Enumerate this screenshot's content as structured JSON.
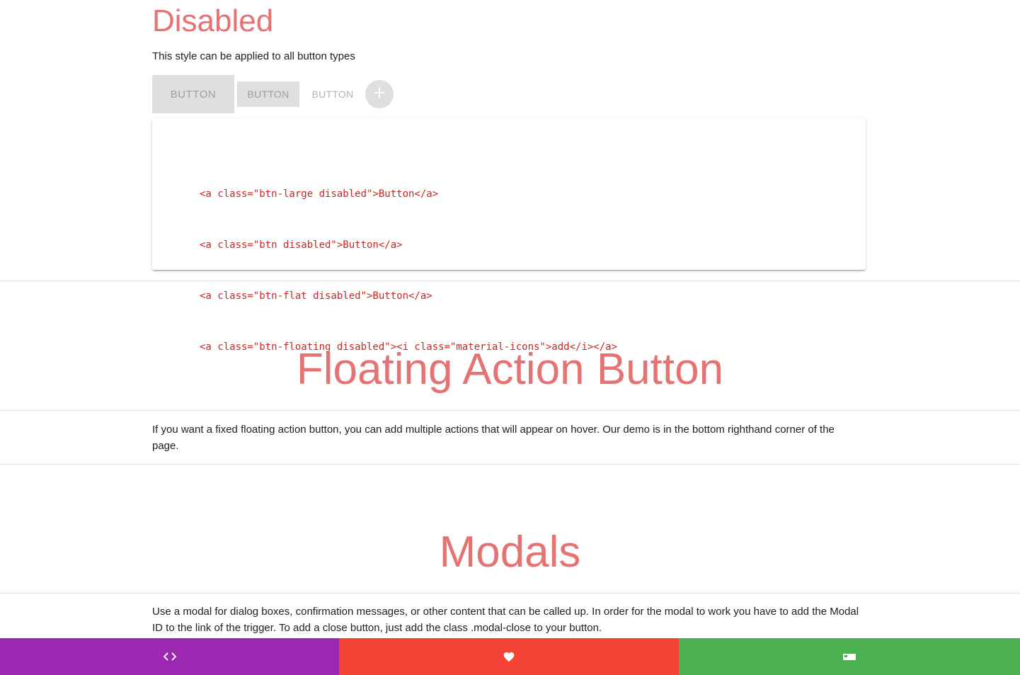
{
  "disabled_section": {
    "title": "Disabled",
    "subtitle": "This style can be applied to all button types",
    "buttons": {
      "large": "BUTTON",
      "normal": "BUTTON",
      "flat": "BUTTON"
    },
    "floating_icon": "plus-icon",
    "code_lines": [
      "<a class=\"btn-large disabled\">Button</a>",
      "<a class=\"btn disabled\">Button</a>",
      "<a class=\"btn-flat disabled\">Button</a>",
      "<a class=\"btn-floating disabled\"><i class=\"material-icons\">add</i></a>"
    ]
  },
  "fab_section": {
    "title": "Floating Action Button",
    "description": "If you want a fixed floating action button, you can add multiple actions that will appear on hover. Our demo is in the bottom righthand corner of the page."
  },
  "modals_section": {
    "title": "Modals",
    "description": "Use a modal for dialog boxes, confirmation messages, or other content that can be called up. In order for the modal to work you have to add the Modal ID to the link of the trigger. To add a close button, just add the class .modal-close to your button."
  },
  "bottom_bar": {
    "items": [
      {
        "icon": "code-icon",
        "color": "#9c27b0"
      },
      {
        "icon": "heart-icon",
        "color": "#f44336"
      },
      {
        "icon": "hotel-icon",
        "color": "#4caf50"
      }
    ]
  },
  "colors": {
    "accent": "#e57373",
    "code": "#c62828",
    "disabled_bg": "#dfdfdf",
    "disabled_text": "#9f9f9f"
  }
}
